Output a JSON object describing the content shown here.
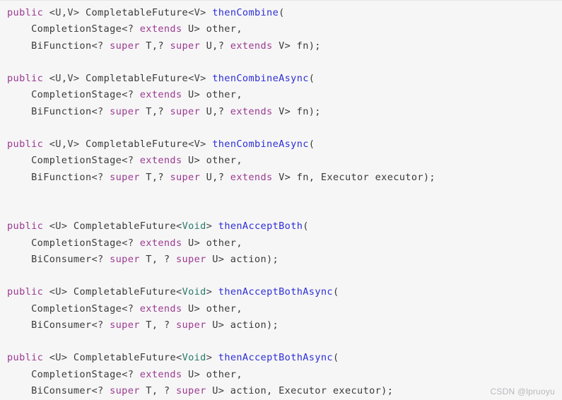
{
  "editor": {
    "language": "java",
    "background_color": "#f6f6f7",
    "colors": {
      "keyword": "#9b3a8f",
      "method": "#2e2ed6",
      "type": "#3a3a3a",
      "void_type": "#2a7a6a",
      "default_text": "#3a3a3a"
    }
  },
  "watermark": {
    "text": "CSDN @lpruoyu"
  },
  "code": {
    "lines": [
      {
        "id": "line-1",
        "tokens": [
          {
            "t": "public",
            "c": "kw"
          },
          {
            "t": " ",
            "c": "pun"
          },
          {
            "t": "<U,V>",
            "c": "gen"
          },
          {
            "t": " ",
            "c": "pun"
          },
          {
            "t": "CompletableFuture",
            "c": "typ"
          },
          {
            "t": "<V>",
            "c": "gen"
          },
          {
            "t": " ",
            "c": "pun"
          },
          {
            "t": "thenCombine",
            "c": "mth"
          },
          {
            "t": "(",
            "c": "pun"
          }
        ]
      },
      {
        "id": "line-2",
        "tokens": [
          {
            "t": "    ",
            "c": "pun"
          },
          {
            "t": "CompletionStage",
            "c": "typ"
          },
          {
            "t": "<? ",
            "c": "gen"
          },
          {
            "t": "extends",
            "c": "kw"
          },
          {
            "t": " U> other,",
            "c": "pun"
          }
        ]
      },
      {
        "id": "line-3",
        "tokens": [
          {
            "t": "    ",
            "c": "pun"
          },
          {
            "t": "BiFunction",
            "c": "typ"
          },
          {
            "t": "<? ",
            "c": "gen"
          },
          {
            "t": "super",
            "c": "kw"
          },
          {
            "t": " T,? ",
            "c": "pun"
          },
          {
            "t": "super",
            "c": "kw"
          },
          {
            "t": " U,? ",
            "c": "pun"
          },
          {
            "t": "extends",
            "c": "kw"
          },
          {
            "t": " V> fn);",
            "c": "pun"
          }
        ]
      },
      {
        "id": "line-4",
        "tokens": []
      },
      {
        "id": "line-5",
        "tokens": [
          {
            "t": "public",
            "c": "kw"
          },
          {
            "t": " ",
            "c": "pun"
          },
          {
            "t": "<U,V>",
            "c": "gen"
          },
          {
            "t": " ",
            "c": "pun"
          },
          {
            "t": "CompletableFuture",
            "c": "typ"
          },
          {
            "t": "<V>",
            "c": "gen"
          },
          {
            "t": " ",
            "c": "pun"
          },
          {
            "t": "thenCombineAsync",
            "c": "mth"
          },
          {
            "t": "(",
            "c": "pun"
          }
        ]
      },
      {
        "id": "line-6",
        "tokens": [
          {
            "t": "    ",
            "c": "pun"
          },
          {
            "t": "CompletionStage",
            "c": "typ"
          },
          {
            "t": "<? ",
            "c": "gen"
          },
          {
            "t": "extends",
            "c": "kw"
          },
          {
            "t": " U> other,",
            "c": "pun"
          }
        ]
      },
      {
        "id": "line-7",
        "tokens": [
          {
            "t": "    ",
            "c": "pun"
          },
          {
            "t": "BiFunction",
            "c": "typ"
          },
          {
            "t": "<? ",
            "c": "gen"
          },
          {
            "t": "super",
            "c": "kw"
          },
          {
            "t": " T,? ",
            "c": "pun"
          },
          {
            "t": "super",
            "c": "kw"
          },
          {
            "t": " U,? ",
            "c": "pun"
          },
          {
            "t": "extends",
            "c": "kw"
          },
          {
            "t": " V> fn);",
            "c": "pun"
          }
        ]
      },
      {
        "id": "line-8",
        "tokens": []
      },
      {
        "id": "line-9",
        "tokens": [
          {
            "t": "public",
            "c": "kw"
          },
          {
            "t": " ",
            "c": "pun"
          },
          {
            "t": "<U,V>",
            "c": "gen"
          },
          {
            "t": " ",
            "c": "pun"
          },
          {
            "t": "CompletableFuture",
            "c": "typ"
          },
          {
            "t": "<V>",
            "c": "gen"
          },
          {
            "t": " ",
            "c": "pun"
          },
          {
            "t": "thenCombineAsync",
            "c": "mth"
          },
          {
            "t": "(",
            "c": "pun"
          }
        ]
      },
      {
        "id": "line-10",
        "tokens": [
          {
            "t": "    ",
            "c": "pun"
          },
          {
            "t": "CompletionStage",
            "c": "typ"
          },
          {
            "t": "<? ",
            "c": "gen"
          },
          {
            "t": "extends",
            "c": "kw"
          },
          {
            "t": " U> other,",
            "c": "pun"
          }
        ]
      },
      {
        "id": "line-11",
        "tokens": [
          {
            "t": "    ",
            "c": "pun"
          },
          {
            "t": "BiFunction",
            "c": "typ"
          },
          {
            "t": "<? ",
            "c": "gen"
          },
          {
            "t": "super",
            "c": "kw"
          },
          {
            "t": " T,? ",
            "c": "pun"
          },
          {
            "t": "super",
            "c": "kw"
          },
          {
            "t": " U,? ",
            "c": "pun"
          },
          {
            "t": "extends",
            "c": "kw"
          },
          {
            "t": " V> fn, ",
            "c": "pun"
          },
          {
            "t": "Executor",
            "c": "typ"
          },
          {
            "t": " executor);",
            "c": "pun"
          }
        ]
      },
      {
        "id": "line-12",
        "tokens": []
      },
      {
        "id": "line-13",
        "tokens": []
      },
      {
        "id": "line-14",
        "tokens": [
          {
            "t": "public",
            "c": "kw"
          },
          {
            "t": " ",
            "c": "pun"
          },
          {
            "t": "<U>",
            "c": "gen"
          },
          {
            "t": " ",
            "c": "pun"
          },
          {
            "t": "CompletableFuture",
            "c": "typ"
          },
          {
            "t": "<",
            "c": "gen"
          },
          {
            "t": "Void",
            "c": "void"
          },
          {
            "t": ">",
            "c": "gen"
          },
          {
            "t": " ",
            "c": "pun"
          },
          {
            "t": "thenAcceptBoth",
            "c": "mth"
          },
          {
            "t": "(",
            "c": "pun"
          }
        ]
      },
      {
        "id": "line-15",
        "tokens": [
          {
            "t": "    ",
            "c": "pun"
          },
          {
            "t": "CompletionStage",
            "c": "typ"
          },
          {
            "t": "<? ",
            "c": "gen"
          },
          {
            "t": "extends",
            "c": "kw"
          },
          {
            "t": " U> other,",
            "c": "pun"
          }
        ]
      },
      {
        "id": "line-16",
        "tokens": [
          {
            "t": "    ",
            "c": "pun"
          },
          {
            "t": "BiConsumer",
            "c": "typ"
          },
          {
            "t": "<? ",
            "c": "gen"
          },
          {
            "t": "super",
            "c": "kw"
          },
          {
            "t": " T, ? ",
            "c": "pun"
          },
          {
            "t": "super",
            "c": "kw"
          },
          {
            "t": " U> action);",
            "c": "pun"
          }
        ]
      },
      {
        "id": "line-17",
        "tokens": []
      },
      {
        "id": "line-18",
        "tokens": [
          {
            "t": "public",
            "c": "kw"
          },
          {
            "t": " ",
            "c": "pun"
          },
          {
            "t": "<U>",
            "c": "gen"
          },
          {
            "t": " ",
            "c": "pun"
          },
          {
            "t": "CompletableFuture",
            "c": "typ"
          },
          {
            "t": "<",
            "c": "gen"
          },
          {
            "t": "Void",
            "c": "void"
          },
          {
            "t": ">",
            "c": "gen"
          },
          {
            "t": " ",
            "c": "pun"
          },
          {
            "t": "thenAcceptBothAsync",
            "c": "mth"
          },
          {
            "t": "(",
            "c": "pun"
          }
        ]
      },
      {
        "id": "line-19",
        "tokens": [
          {
            "t": "    ",
            "c": "pun"
          },
          {
            "t": "CompletionStage",
            "c": "typ"
          },
          {
            "t": "<? ",
            "c": "gen"
          },
          {
            "t": "extends",
            "c": "kw"
          },
          {
            "t": " U> other,",
            "c": "pun"
          }
        ]
      },
      {
        "id": "line-20",
        "tokens": [
          {
            "t": "    ",
            "c": "pun"
          },
          {
            "t": "BiConsumer",
            "c": "typ"
          },
          {
            "t": "<? ",
            "c": "gen"
          },
          {
            "t": "super",
            "c": "kw"
          },
          {
            "t": " T, ? ",
            "c": "pun"
          },
          {
            "t": "super",
            "c": "kw"
          },
          {
            "t": " U> action);",
            "c": "pun"
          }
        ]
      },
      {
        "id": "line-21",
        "tokens": []
      },
      {
        "id": "line-22",
        "tokens": [
          {
            "t": "public",
            "c": "kw"
          },
          {
            "t": " ",
            "c": "pun"
          },
          {
            "t": "<U>",
            "c": "gen"
          },
          {
            "t": " ",
            "c": "pun"
          },
          {
            "t": "CompletableFuture",
            "c": "typ"
          },
          {
            "t": "<",
            "c": "gen"
          },
          {
            "t": "Void",
            "c": "void"
          },
          {
            "t": ">",
            "c": "gen"
          },
          {
            "t": " ",
            "c": "pun"
          },
          {
            "t": "thenAcceptBothAsync",
            "c": "mth"
          },
          {
            "t": "(",
            "c": "pun"
          }
        ]
      },
      {
        "id": "line-23",
        "tokens": [
          {
            "t": "    ",
            "c": "pun"
          },
          {
            "t": "CompletionStage",
            "c": "typ"
          },
          {
            "t": "<? ",
            "c": "gen"
          },
          {
            "t": "extends",
            "c": "kw"
          },
          {
            "t": " U> other,",
            "c": "pun"
          }
        ]
      },
      {
        "id": "line-24",
        "tokens": [
          {
            "t": "    ",
            "c": "pun"
          },
          {
            "t": "BiConsumer",
            "c": "typ"
          },
          {
            "t": "<? ",
            "c": "gen"
          },
          {
            "t": "super",
            "c": "kw"
          },
          {
            "t": " T, ? ",
            "c": "pun"
          },
          {
            "t": "super",
            "c": "kw"
          },
          {
            "t": " U> action, ",
            "c": "pun"
          },
          {
            "t": "Executor",
            "c": "typ"
          },
          {
            "t": " executor);",
            "c": "pun"
          }
        ]
      }
    ]
  }
}
